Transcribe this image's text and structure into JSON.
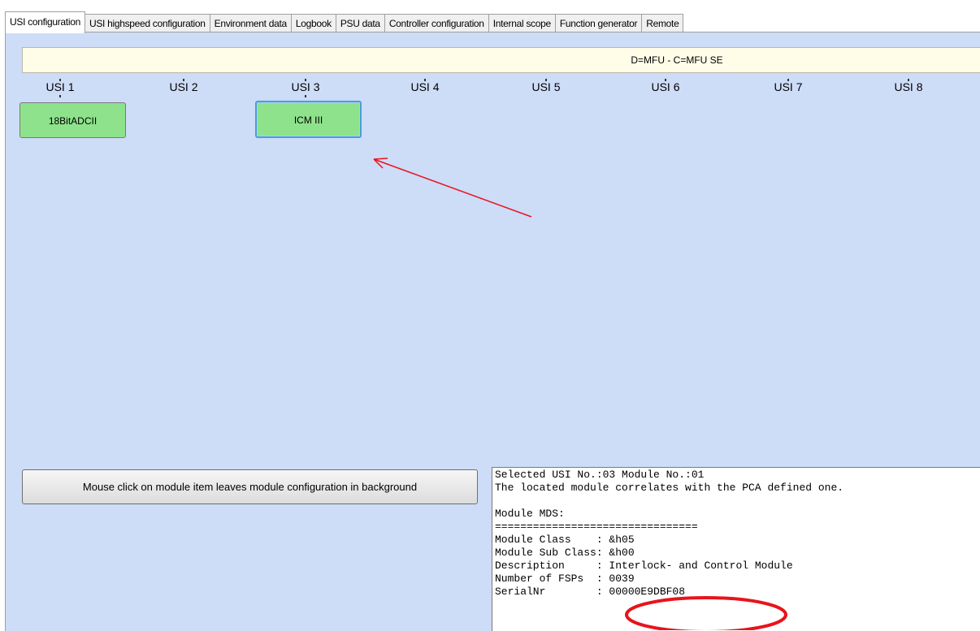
{
  "tabs": [
    "USI configuration",
    "USI highspeed configuration",
    "Environment data",
    "Logbook",
    "PSU data",
    "Controller configuration",
    "Internal scope",
    "Function generator",
    "Remote"
  ],
  "header": {
    "text": "D=MFU - C=MFU SE"
  },
  "usi_slots": [
    "USI 1",
    "USI 2",
    "USI 3",
    "USI 4",
    "USI 5",
    "USI 6",
    "USI 7",
    "USI 8"
  ],
  "modules": [
    {
      "label": "18BitADCII",
      "slot": "USI 1",
      "selected": false
    },
    {
      "label": "ICM III",
      "slot": "USI 3",
      "selected": true
    }
  ],
  "config_button": {
    "label": "Mouse click on module item leaves module configuration in background"
  },
  "info_lines": [
    "Selected USI No.:03 Module No.:01",
    "The located module correlates with the PCA defined one.",
    "",
    "Module MDS:",
    "================================",
    "Module Class    : &h05",
    "Module Sub Class: &h00",
    "Description     : Interlock- and Control Module",
    "Number of FSPs  : 0039",
    "SerialNr        : 00000E9DBF08"
  ],
  "colors": {
    "panel": "#cddcf7",
    "module": "#8ee28c",
    "annotation": "#e8141c"
  }
}
